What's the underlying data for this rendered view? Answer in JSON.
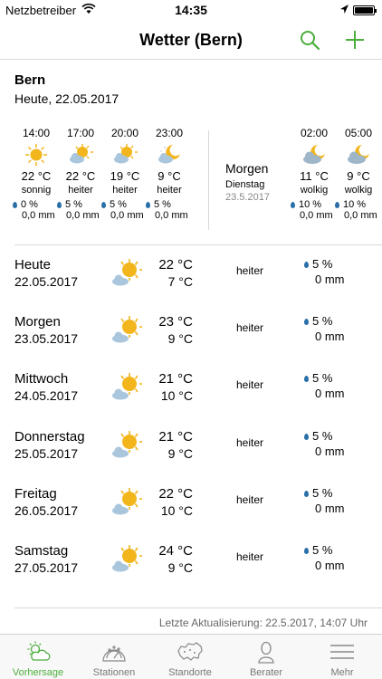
{
  "status": {
    "carrier": "Netzbetreiber",
    "time": "14:35"
  },
  "nav": {
    "title": "Wetter (Bern)"
  },
  "location": {
    "name": "Bern",
    "date_line": "Heute, 22.05.2017"
  },
  "hourly_today": [
    {
      "time": "14:00",
      "icon": "sun-icon",
      "temp": "22 °C",
      "desc": "sonnig",
      "precip": "0 %",
      "rain": "0,0 mm"
    },
    {
      "time": "17:00",
      "icon": "sun-cloud-icon",
      "temp": "22 °C",
      "desc": "heiter",
      "precip": "5 %",
      "rain": "0,0 mm"
    },
    {
      "time": "20:00",
      "icon": "sun-cloud-icon",
      "temp": "19 °C",
      "desc": "heiter",
      "precip": "5 %",
      "rain": "0,0 mm"
    },
    {
      "time": "23:00",
      "icon": "moon-cloud-icon",
      "temp": "9 °C",
      "desc": "heiter",
      "precip": "5 %",
      "rain": "0,0 mm"
    }
  ],
  "next_day": {
    "name": "Morgen",
    "weekday": "Dienstag",
    "date": "23.5.2017"
  },
  "hourly_next": [
    {
      "time": "02:00",
      "icon": "moon-cloud-icon",
      "temp": "11 °C",
      "desc": "wolkig",
      "precip": "10 %",
      "rain": "0,0 mm"
    },
    {
      "time": "05:00",
      "icon": "moon-cloud-icon",
      "temp": "9 °C",
      "desc": "wolkig",
      "precip": "10 %",
      "rain": "0,0 mm"
    }
  ],
  "forecast": [
    {
      "day": "Heute",
      "date": "22.05.2017",
      "max": "22 °C",
      "min": "7 °C",
      "desc": "heiter",
      "precip": "5 %",
      "rain": "0 mm"
    },
    {
      "day": "Morgen",
      "date": "23.05.2017",
      "max": "23 °C",
      "min": "9 °C",
      "desc": "heiter",
      "precip": "5 %",
      "rain": "0 mm"
    },
    {
      "day": "Mittwoch",
      "date": "24.05.2017",
      "max": "21 °C",
      "min": "10 °C",
      "desc": "heiter",
      "precip": "5 %",
      "rain": "0 mm"
    },
    {
      "day": "Donnerstag",
      "date": "25.05.2017",
      "max": "21 °C",
      "min": "9 °C",
      "desc": "heiter",
      "precip": "5 %",
      "rain": "0 mm"
    },
    {
      "day": "Freitag",
      "date": "26.05.2017",
      "max": "22 °C",
      "min": "10 °C",
      "desc": "heiter",
      "precip": "5 %",
      "rain": "0 mm"
    },
    {
      "day": "Samstag",
      "date": "27.05.2017",
      "max": "24 °C",
      "min": "9 °C",
      "desc": "heiter",
      "precip": "5 %",
      "rain": "0 mm"
    }
  ],
  "updated": "Letzte Aktualisierung: 22.5.2017, 14:07 Uhr",
  "tabs": [
    {
      "label": "Vorhersage",
      "icon": "forecast-icon",
      "active": true
    },
    {
      "label": "Stationen",
      "icon": "stations-icon",
      "active": false
    },
    {
      "label": "Standorte",
      "icon": "switzerland-map-icon",
      "active": false
    },
    {
      "label": "Berater",
      "icon": "advisor-icon",
      "active": false
    },
    {
      "label": "Mehr",
      "icon": "menu-icon",
      "active": false
    }
  ],
  "colors": {
    "accent": "#4cae3d",
    "sun": "#f2b51c",
    "cloud": "#a9c6dd",
    "drop": "#2a6fa8"
  }
}
